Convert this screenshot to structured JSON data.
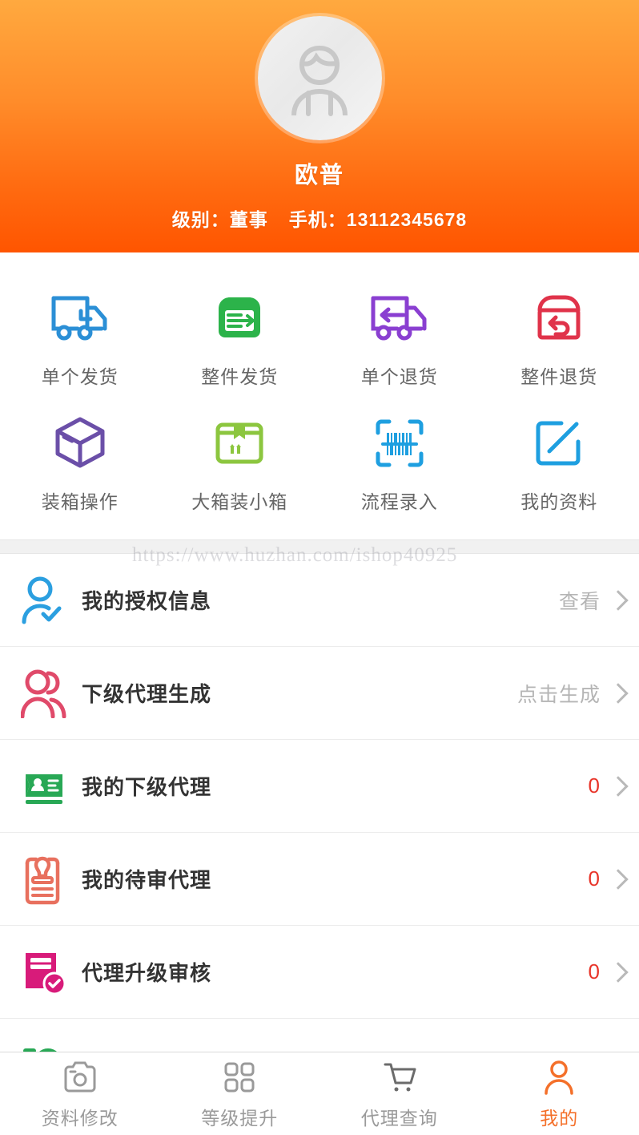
{
  "header": {
    "avatar_icon": "user-avatar-icon",
    "name": "欧普",
    "level_label": "级别：董事",
    "phone_label": "手机：13112345678",
    "gradient_from": "#ffa93f",
    "gradient_to": "#ff5500"
  },
  "grid": {
    "items": [
      {
        "label": "单个发货",
        "icon": "truck-clock-icon",
        "color": "#2b8fd6"
      },
      {
        "label": "整件发货",
        "icon": "box-arrow-right-icon",
        "color": "#2cb34a"
      },
      {
        "label": "单个退货",
        "icon": "truck-arrow-left-icon",
        "color": "#8a3fd1"
      },
      {
        "label": "整件退货",
        "icon": "box-return-icon",
        "color": "#e0334a"
      },
      {
        "label": "装箱操作",
        "icon": "cube-3d-icon",
        "color": "#6b4fa8"
      },
      {
        "label": "大箱装小箱",
        "icon": "sealed-carton-icon",
        "color": "#8cc63f"
      },
      {
        "label": "流程录入",
        "icon": "barcode-scan-icon",
        "color": "#1e9fe0"
      },
      {
        "label": "我的资料",
        "icon": "edit-square-icon",
        "color": "#1e9fe0"
      }
    ]
  },
  "watermark": {
    "text": "https://www.huzhan.com/ishop40925"
  },
  "list": {
    "rows": [
      {
        "title": "我的授权信息",
        "value": "查看",
        "value_kind": "text",
        "icon": "user-check-icon",
        "color": "#2b9fe0"
      },
      {
        "title": "下级代理生成",
        "value": "点击生成",
        "value_kind": "text",
        "icon": "users-add-icon",
        "color": "#e04a6a"
      },
      {
        "title": "我的下级代理",
        "value": "0",
        "value_kind": "num",
        "icon": "id-card-icon",
        "color": "#28a855"
      },
      {
        "title": "我的待审代理",
        "value": "0",
        "value_kind": "num",
        "icon": "stamp-clipboard-icon",
        "color": "#e8705e"
      },
      {
        "title": "代理升级审核",
        "value": "0",
        "value_kind": "num",
        "icon": "doc-check-icon",
        "color": "#d81b7a"
      }
    ],
    "partial_row": {
      "icon": "green-partial-icon",
      "color": "#28a855"
    }
  },
  "tabbar": {
    "tabs": [
      {
        "label": "资料修改",
        "icon": "camera-icon",
        "active": false
      },
      {
        "label": "等级提升",
        "icon": "grid-icon",
        "active": false
      },
      {
        "label": "代理查询",
        "icon": "cart-icon",
        "active": false
      },
      {
        "label": "我的",
        "icon": "person-icon",
        "active": true
      }
    ],
    "active_color": "#f4702a",
    "inactive_color": "#9a9a9a"
  }
}
